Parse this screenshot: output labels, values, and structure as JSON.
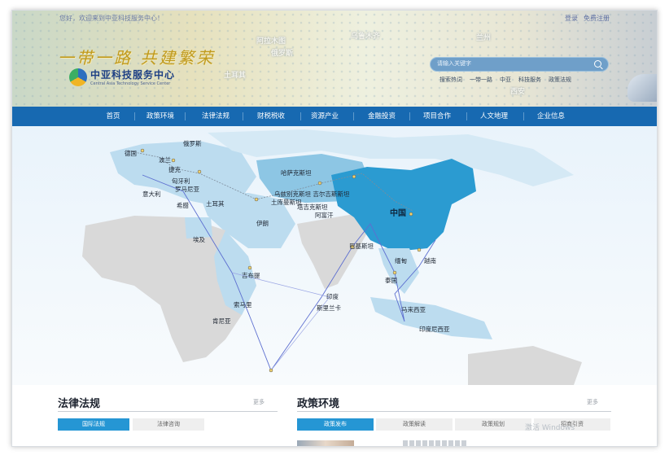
{
  "header": {
    "welcome": "您好，欢迎来到中亚科技服务中心！",
    "links": [
      "登录",
      "免费注册"
    ],
    "slogan": "一带一路  共建繁荣",
    "logo_title": "中亚科技服务中心",
    "logo_subtitle": "Central Asia Technology Service Center",
    "banner_places": [
      "阿拉木图",
      "俄罗斯",
      "土耳其",
      "乌鲁木齐",
      "西安",
      "兰州"
    ],
    "search": {
      "placeholder": "请输入关键字"
    },
    "hot_words": [
      "搜索热词",
      "一带一路",
      "中亚",
      "科技服务",
      "政策法规"
    ]
  },
  "nav": {
    "items": [
      "首页",
      "政策环境",
      "法律法规",
      "财税税收",
      "资源产业",
      "金融投资",
      "项目合作",
      "人文地理",
      "企业信息"
    ]
  },
  "map": {
    "labels": {
      "eastern_europe": "俄罗斯",
      "poland": "波兰",
      "germany": "德国",
      "czech": "捷克",
      "hungary": "匈牙利",
      "romania": "罗马尼亚",
      "italy": "意大利",
      "greece": "希腊",
      "turkey": "土耳其",
      "iran": "伊朗",
      "egypt": "埃及",
      "djibouti": "吉布提",
      "kenya": "肯尼亚",
      "somalia": "索马里",
      "kazakhstan": "哈萨克斯坦",
      "central_asia": "乌兹别克斯坦 吉尔吉斯斯坦",
      "turkmenistan": "土库曼斯坦",
      "tajikistan": "塔吉克斯坦",
      "afghanistan": "阿富汗",
      "pakistan": "巴基斯坦",
      "india": "印度",
      "sri_lanka": "斯里兰卡",
      "china": "中国",
      "myanmar": "缅甸",
      "thailand": "泰国",
      "vietnam": "越南",
      "malaysia": "马来西亚",
      "indonesia": "印度尼西亚"
    },
    "colors": {
      "ocean": "#eef6fc",
      "land": "#d9d9d9",
      "partner": "#bcdcef",
      "china": "#2b9bd1",
      "route": "#5d6fd0"
    }
  },
  "sections": {
    "left": {
      "title": "法律法规",
      "more": "更多",
      "tabs": [
        "国际法规",
        "法律咨询"
      ]
    },
    "right": {
      "title": "政策环境",
      "more": "更多",
      "tabs": [
        "政策发布",
        "政策解读",
        "政策规划",
        "招商引资"
      ]
    }
  },
  "watermark": "激活 Windows"
}
